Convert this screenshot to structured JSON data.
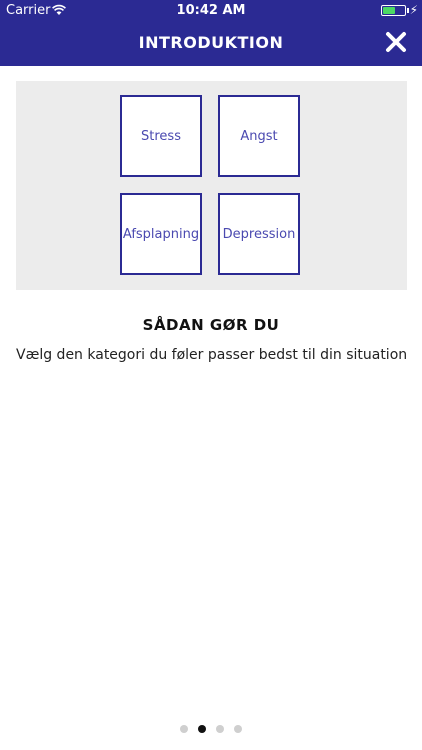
{
  "status_bar": {
    "carrier": "Carrier",
    "time": "10:42 AM"
  },
  "header": {
    "title": "INTRODUKTION"
  },
  "categories": [
    "Stress",
    "Angst",
    "Afsplapning",
    "Depression"
  ],
  "instructions": {
    "heading": "SÅDAN GØR DU",
    "text": "Vælg den kategori du føler passer bedst til din situation"
  },
  "pager": {
    "count": 4,
    "active_index": 1
  },
  "colors": {
    "primary": "#2b2a93",
    "battery": "#4cd964"
  }
}
